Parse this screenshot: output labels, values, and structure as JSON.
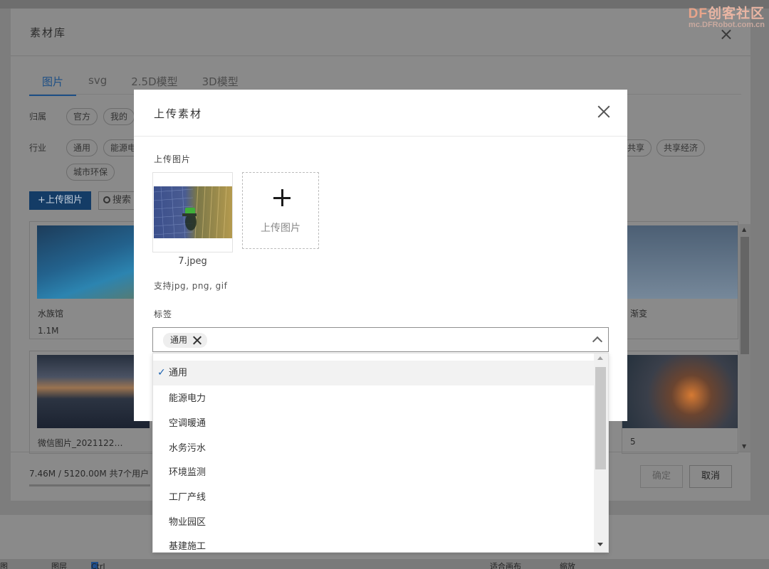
{
  "watermark": {
    "logo_df": "DF",
    "logo_rest": "创客社区",
    "url": "mc.DFRobot.com.cn"
  },
  "library": {
    "title": "素材库",
    "close_icon": "×",
    "tabs": [
      {
        "label": "图片",
        "active": true
      },
      {
        "label": "svg"
      },
      {
        "label": "2.5D模型"
      },
      {
        "label": "3D模型"
      }
    ],
    "ownership_label": "归属",
    "ownership_chips": [
      "官方",
      "我的"
    ],
    "industry_label": "行业",
    "industry_chips_left": [
      "通用",
      "能源电"
    ],
    "industry_chips_right": [
      "共享",
      "共享经济"
    ],
    "industry_chips_row2": [
      "城市环保"
    ],
    "upload_button": "上传图片",
    "search_placeholder": "搜索",
    "cards": [
      {
        "name": "水族馆",
        "size": "1.1M"
      },
      {
        "name": "渐变",
        "size": ""
      },
      {
        "name": "微信图片_2021122…",
        "size": ""
      },
      {
        "name": "5",
        "size": ""
      }
    ],
    "usage": "7.46M / 5120.00M  共7个用户",
    "ok_button": "确定",
    "cancel_button": "取消"
  },
  "upload": {
    "title": "上传素材",
    "upload_image_label": "上传图片",
    "file_name": "7.jpeg",
    "add_text": "上传图片",
    "hint": "支持jpg, png, gif",
    "tag_label": "标签",
    "selected_tag": "通用"
  },
  "dropdown": {
    "items": [
      {
        "label": "通用",
        "selected": true
      },
      {
        "label": "能源电力"
      },
      {
        "label": "空调暖通"
      },
      {
        "label": "水务污水"
      },
      {
        "label": "环境监测"
      },
      {
        "label": "工厂产线"
      },
      {
        "label": "物业园区"
      },
      {
        "label": "基建施工"
      }
    ],
    "check_icon": "✓"
  },
  "background": {
    "status_items": [
      "图",
      "图层",
      "Ctrl",
      "适合画布",
      "缩放"
    ]
  },
  "colors": {
    "accent": "#1d63b0",
    "primary_button": "#143c66"
  }
}
